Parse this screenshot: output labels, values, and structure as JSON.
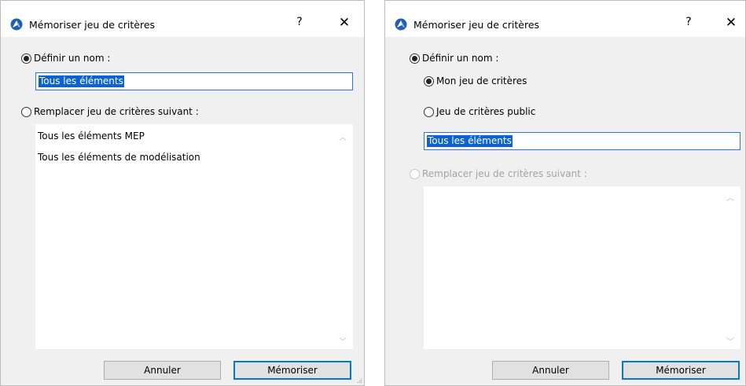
{
  "dialogs": [
    {
      "title": "Mémoriser jeu de critères",
      "help": "?",
      "close": "✕",
      "define_name_label": "Définir un nom :",
      "name_value": "Tous les éléments",
      "replace_label": "Remplacer jeu de critères suivant :",
      "list_items": [
        "Tous les éléments MEP",
        "Tous les éléments de modélisation"
      ],
      "cancel_label": "Annuler",
      "save_label": "Mémoriser"
    },
    {
      "title": "Mémoriser jeu de critères",
      "help": "?",
      "close": "✕",
      "define_name_label": "Définir un nom :",
      "my_set_label": "Mon jeu de critères",
      "public_set_label": "Jeu de critères public",
      "name_value": "Tous les éléments",
      "replace_label": "Remplacer jeu de critères suivant :",
      "cancel_label": "Annuler",
      "save_label": "Mémoriser"
    }
  ],
  "colors": {
    "selection": "#0a62d6",
    "focus_border": "#2f74d0",
    "dialog_bg": "#f0f0f0",
    "disabled_text": "#a3a3a3"
  },
  "icons": {
    "app": "archicad-logo-icon",
    "scroll_up": "chevron-up-icon",
    "scroll_down": "chevron-down-icon"
  }
}
